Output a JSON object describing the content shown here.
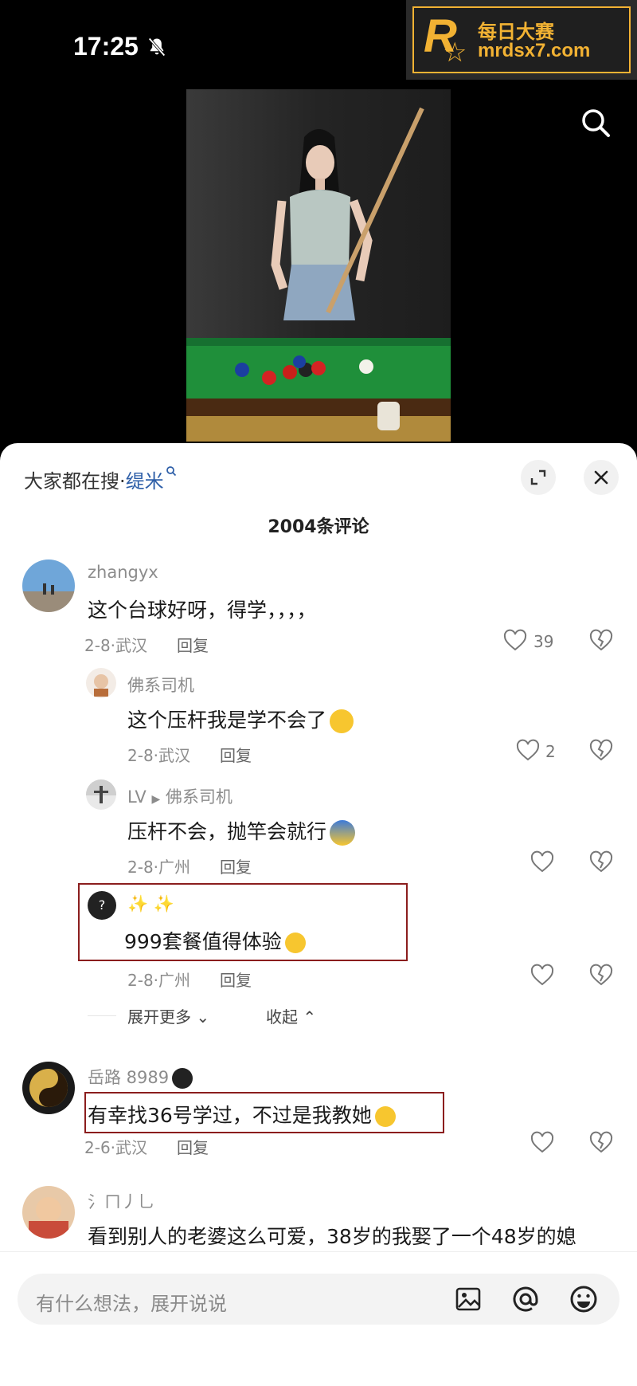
{
  "status_bar": {
    "time": "17:25"
  },
  "watermark": {
    "mark": "R",
    "cn": "每日大赛",
    "url": "mrdsx7.com"
  },
  "header": {
    "hot_prefix": "大家都在搜·",
    "hot_keyword": "缇米"
  },
  "comments_count": "2004条评论",
  "comments": [
    {
      "user": "zhangyx",
      "text": "这个台球好呀，得学，，，，",
      "meta": "2-8·武汉",
      "reply": "回复",
      "likes": "39"
    },
    {
      "user": "佛系司机",
      "text": "这个压杆我是学不会了",
      "meta": "2-8·武汉",
      "reply": "回复",
      "likes": "2"
    },
    {
      "user": "LV",
      "reply_to": "佛系司机",
      "text": "压杆不会，抛竿会就行",
      "meta": "2-8·广州",
      "reply": "回复",
      "likes": ""
    },
    {
      "user": "✨ ✨",
      "text": "999套餐值得体验",
      "meta": "2-8·广州",
      "reply": "回复",
      "likes": ""
    },
    {
      "user": "岳路 8989",
      "text": "有幸找36号学过，不过是我教她",
      "meta": "2-6·武汉",
      "reply": "回复",
      "likes": ""
    },
    {
      "user": "氵ㄇ丿乚",
      "text": "看到别人的老婆这么可爱，38岁的我娶了一个48岁的媳"
    }
  ],
  "expand": {
    "more": "展开更多",
    "collapse": "收起"
  },
  "input": {
    "placeholder": "有什么想法，展开说说"
  },
  "colors": {
    "accent": "#2e5fa8",
    "highlight_border": "#8b1d1d",
    "watermark": "#f2b233"
  }
}
